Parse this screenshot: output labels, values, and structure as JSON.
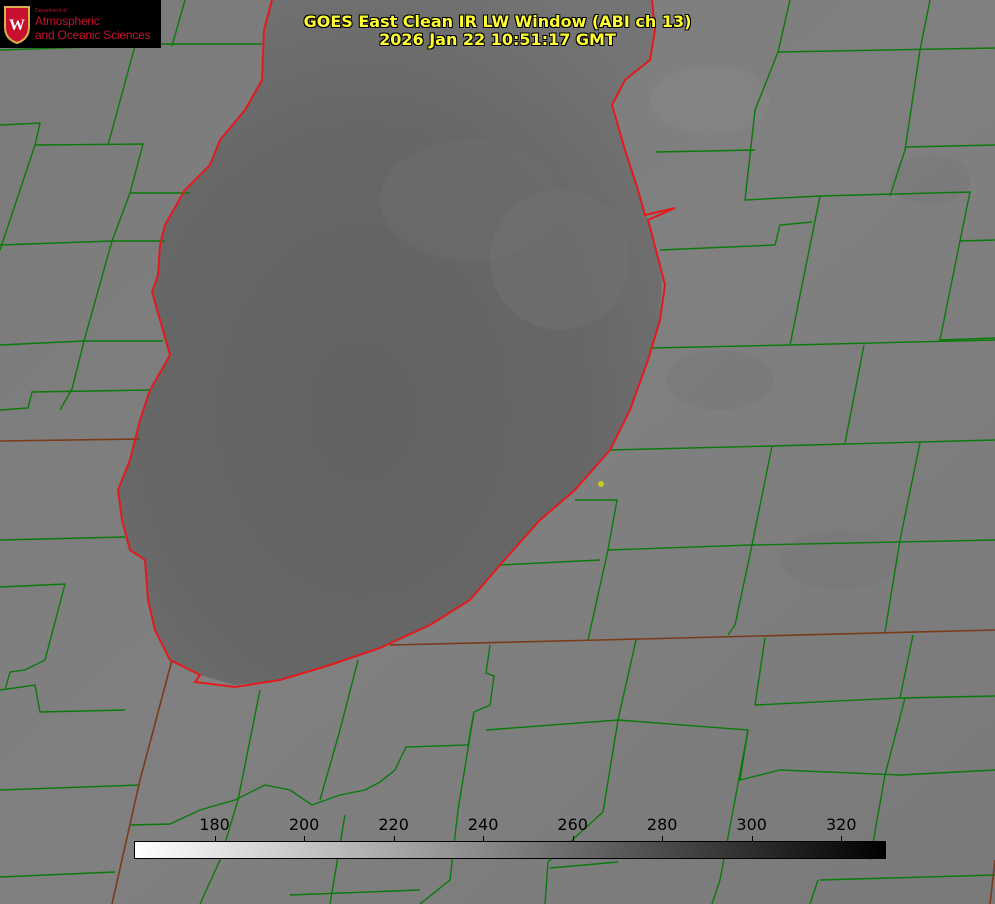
{
  "title": {
    "line1": "GOES East Clean IR LW Window (ABI ch 13)",
    "line2": "2026 Jan 22 10:51:17 GMT"
  },
  "logo": {
    "department": "Department of",
    "line1": "Atmospheric",
    "line2": "and Oceanic Sciences",
    "crest_letter": "W",
    "crest_icon": "university-crest-icon"
  },
  "colorbar": {
    "min": 162,
    "max": 330,
    "gradient": [
      "#ffffff",
      "#000000"
    ],
    "ticks": [
      "180",
      "200",
      "220",
      "240",
      "260",
      "280",
      "300",
      "320"
    ]
  },
  "colors": {
    "land": "#7d7d7d",
    "lake": "#626262",
    "county_lines": "#0a7a0a",
    "coastline": "#e31a1c",
    "title_text": "#ffff33",
    "marker": "#c8c81e"
  }
}
